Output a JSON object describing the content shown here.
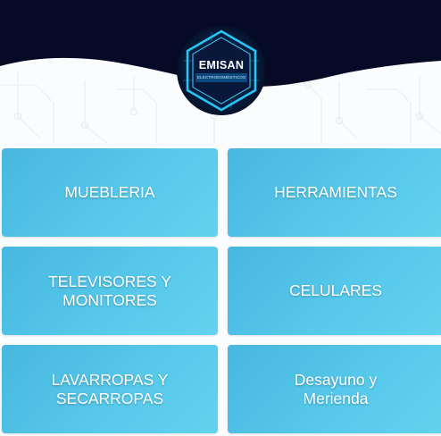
{
  "brand": {
    "name": "EMISAN",
    "tagline": "ELECTRODOMÉSTICOS"
  },
  "colors": {
    "header_background": "#060a26",
    "card_gradient_start": "#47b7df",
    "card_gradient_end": "#62d2ef",
    "logo_glow": "#27c4f5",
    "card_text": "#ffffff"
  },
  "categories": [
    {
      "label": "MUEBLERIA"
    },
    {
      "label": "HERRAMIENTAS"
    },
    {
      "label": "TELEVISORES Y MONITORES"
    },
    {
      "label": "CELULARES"
    },
    {
      "label": "LAVARROPAS Y SECARROPAS"
    },
    {
      "label": "Desayuno y Merienda"
    }
  ]
}
